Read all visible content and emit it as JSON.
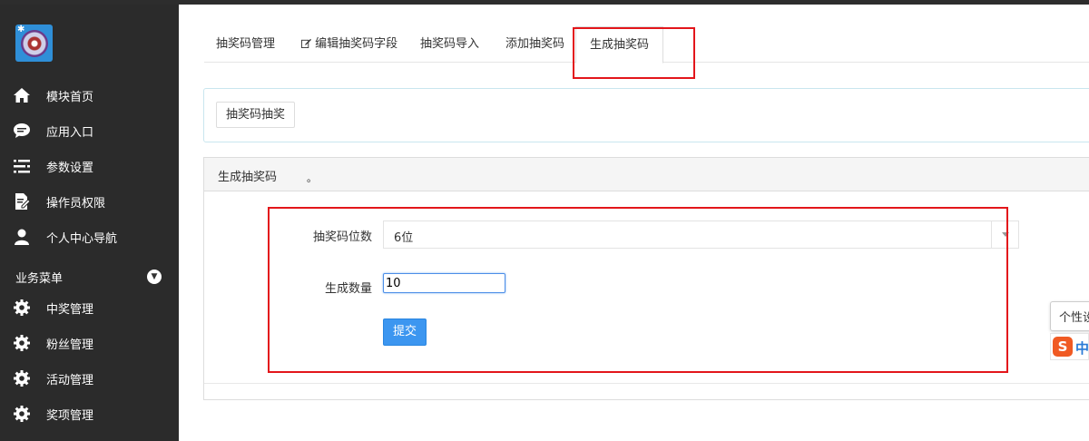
{
  "sidebar": {
    "items": [
      {
        "label": "模块首页",
        "icon": "home-icon"
      },
      {
        "label": "应用入口",
        "icon": "chat-bubble-icon"
      },
      {
        "label": "参数设置",
        "icon": "list-settings-icon"
      },
      {
        "label": "操作员权限",
        "icon": "edit-document-icon"
      },
      {
        "label": "个人中心导航",
        "icon": "user-icon"
      }
    ],
    "section_title": "业务菜单",
    "section_items": [
      {
        "label": "中奖管理",
        "icon": "gear-icon"
      },
      {
        "label": "粉丝管理",
        "icon": "gear-icon"
      },
      {
        "label": "活动管理",
        "icon": "gear-icon"
      },
      {
        "label": "奖项管理",
        "icon": "gear-icon"
      }
    ]
  },
  "tabs": [
    {
      "label": "抽奖码管理"
    },
    {
      "label": "编辑抽奖码字段",
      "icon": "edit-icon"
    },
    {
      "label": "抽奖码导入"
    },
    {
      "label": "添加抽奖码"
    },
    {
      "label": "生成抽奖码",
      "active": true
    }
  ],
  "toolbar": {
    "draw_button": "抽奖码抽奖"
  },
  "form_panel": {
    "title": "生成抽奖码",
    "dot": "。",
    "digits_label": "抽奖码位数",
    "digits_value": "6位",
    "count_label": "生成数量",
    "count_value": "10",
    "submit_label": "提交"
  },
  "overlay": {
    "tooltip_text": "个性设",
    "ime_logo": "S",
    "ime_mode": "中"
  },
  "colors": {
    "sidebar_bg": "#2b2b2b",
    "highlight_red": "#e3161b",
    "primary_blue": "#3c96f0"
  }
}
